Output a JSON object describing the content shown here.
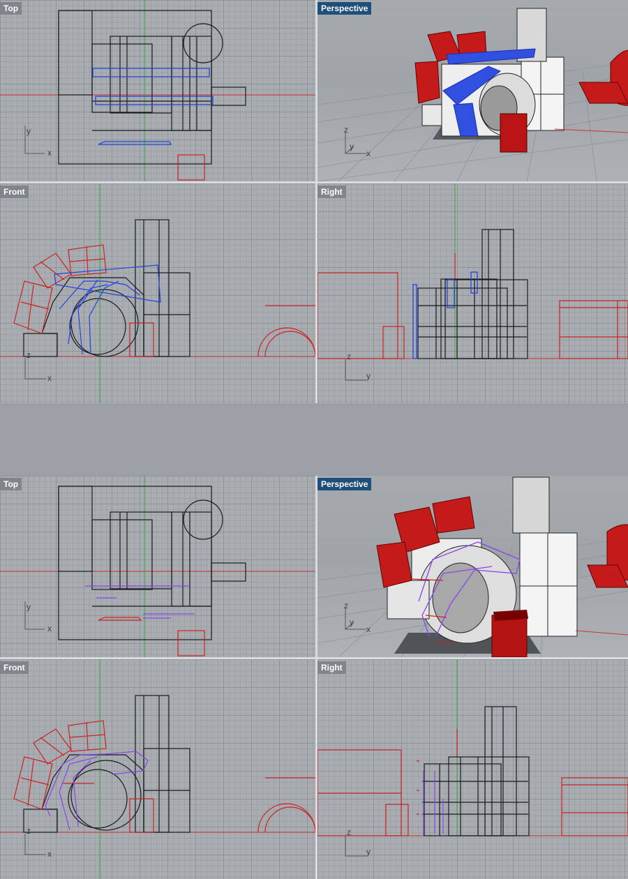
{
  "colors": {
    "active_tab": "#1e4f7c",
    "inactive_tab": "#7f858a",
    "curve_red": "#cc2222",
    "curve_blue": "#2244dd",
    "curve_purple": "#8844ee",
    "edge_black": "#1a1a1a",
    "x_axis": "#cc3333",
    "y_axis": "#33aa33",
    "z_axis": "#2255cc"
  },
  "panels": [
    {
      "state": "before",
      "viewports": {
        "top": {
          "label": "Top",
          "axis_x": "x",
          "axis_y": "y"
        },
        "perspective": {
          "label": "Perspective",
          "axis_x": "x",
          "axis_y": "y",
          "axis_z": "z"
        },
        "front": {
          "label": "Front",
          "axis_x": "x",
          "axis_z": "z"
        },
        "right": {
          "label": "Right",
          "axis_y": "y",
          "axis_z": "z"
        }
      }
    },
    {
      "state": "after",
      "viewports": {
        "top": {
          "label": "Top",
          "axis_x": "x",
          "axis_y": "y"
        },
        "perspective": {
          "label": "Perspective",
          "axis_x": "x",
          "axis_y": "y",
          "axis_z": "z"
        },
        "front": {
          "label": "Front",
          "axis_x": "x",
          "axis_z": "z"
        },
        "right": {
          "label": "Right",
          "axis_y": "y",
          "axis_z": "z"
        }
      }
    }
  ]
}
